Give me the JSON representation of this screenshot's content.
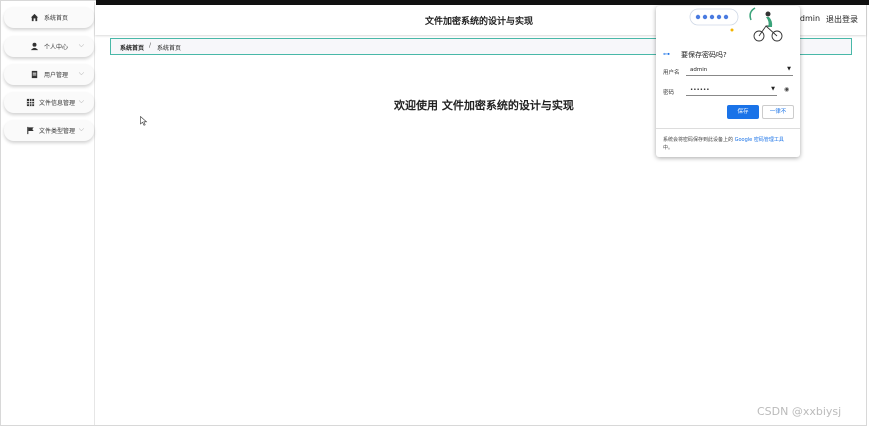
{
  "header": {
    "title": "文件加密系统的设计与实现",
    "user": "admin",
    "logout": "退出登录"
  },
  "sidebar": {
    "items": [
      {
        "label": "系统首页",
        "icon": "home-icon"
      },
      {
        "label": "个人中心",
        "icon": "person-icon"
      },
      {
        "label": "用户管理",
        "icon": "users-icon"
      },
      {
        "label": "文件信息管理",
        "icon": "grid-icon"
      },
      {
        "label": "文件类型管理",
        "icon": "flag-icon"
      }
    ]
  },
  "breadcrumb": {
    "root": "系统首页",
    "separator": "/",
    "current": "系统首页"
  },
  "main": {
    "welcome": "欢迎使用 文件加密系统的设计与实现"
  },
  "password_popup": {
    "title": "要保存密码吗?",
    "username_label": "用户名",
    "username_value": "admin",
    "password_label": "密码",
    "password_value": "••••••",
    "save_label": "保存",
    "never_label": "一律不",
    "footer_text": "系统会将密码保存到此设备上的 ",
    "footer_link": "Google 密码管理工具",
    "footer_suffix": "中。"
  },
  "watermark": "CSDN @xxbiysj",
  "colors": {
    "accent": "#1a73e8",
    "breadcrumb_border": "#49b8a8"
  }
}
